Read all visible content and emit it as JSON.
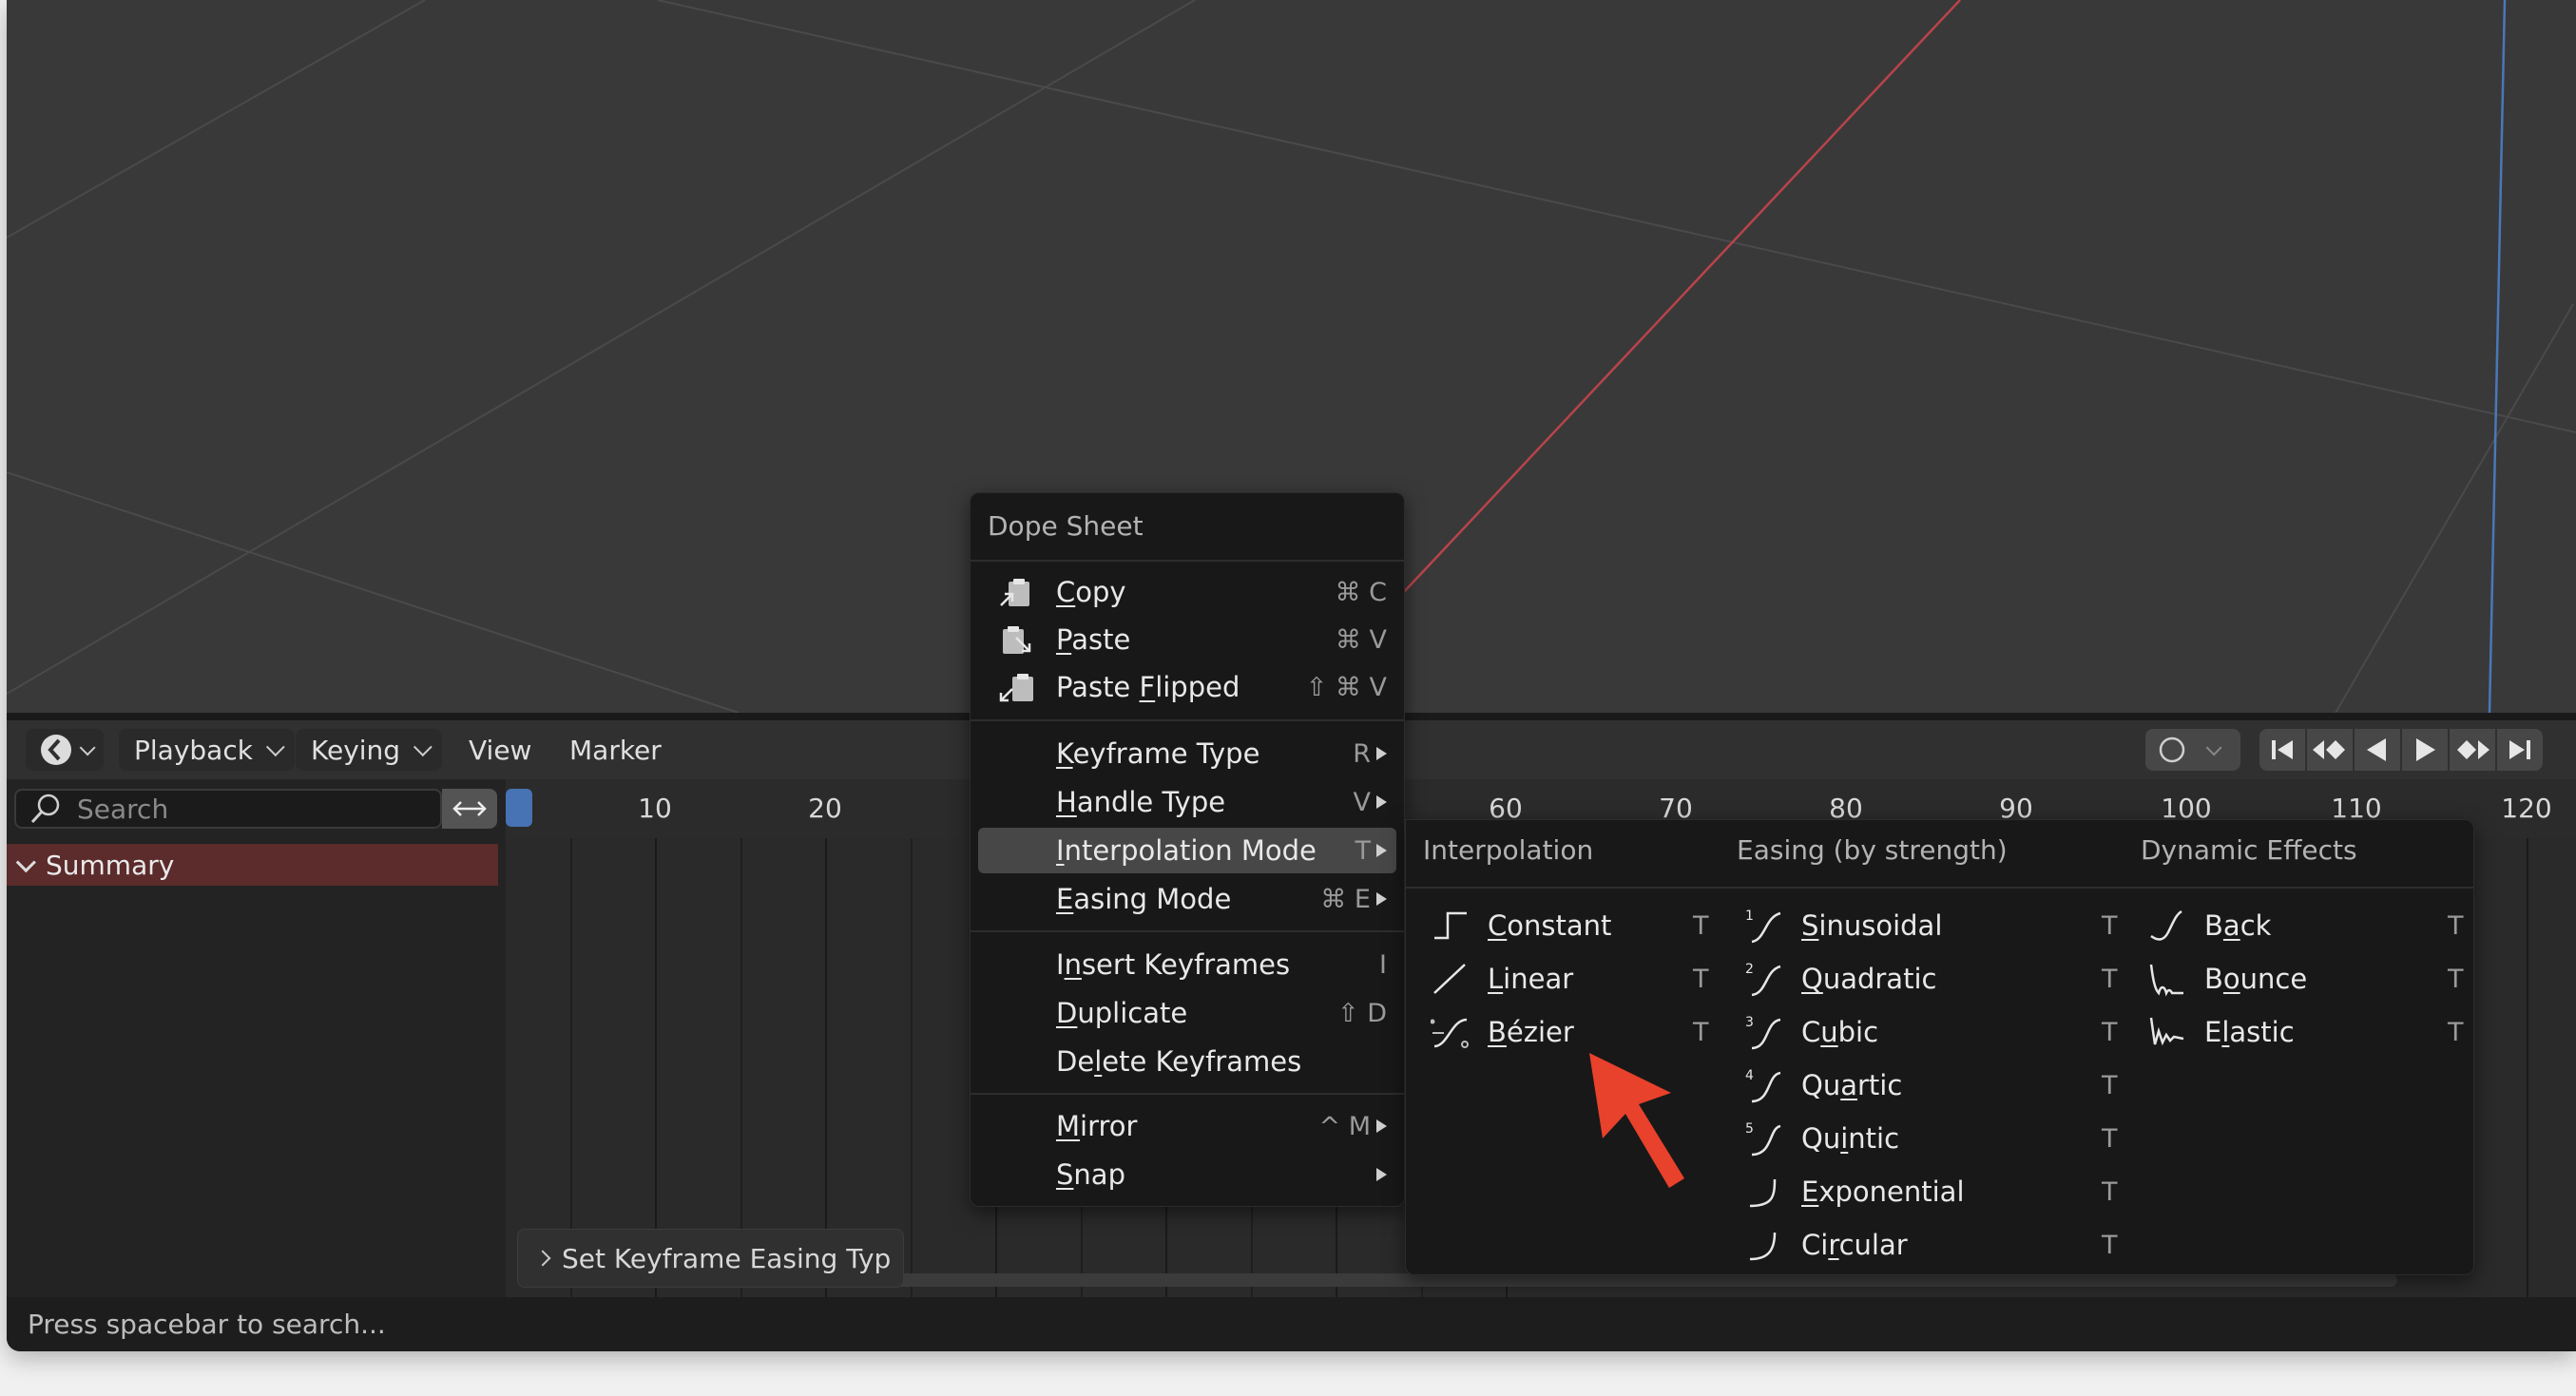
{
  "header": {
    "menus": [
      "Playback",
      "Keying",
      "View",
      "Marker"
    ]
  },
  "search": {
    "placeholder": "Search"
  },
  "channels": {
    "summary_label": "Summary"
  },
  "ruler": {
    "ticks": [
      "10",
      "20",
      "60",
      "70",
      "80",
      "90",
      "100",
      "110",
      "120"
    ]
  },
  "operator_panel": {
    "label": "Set Keyframe Easing Typ"
  },
  "status_bar": {
    "text": "Press spacebar to search..."
  },
  "context_menu": {
    "title": "Dope Sheet",
    "items": [
      {
        "label": "Copy",
        "shortcut": "⌘ C",
        "icon": "copy-icon"
      },
      {
        "label": "Paste",
        "shortcut": "⌘ V",
        "icon": "paste-icon"
      },
      {
        "label": "Paste Flipped",
        "shortcut": "⇧ ⌘ V",
        "icon": "paste-flipped-icon"
      },
      {
        "label": "Keyframe Type",
        "shortcut": "R"
      },
      {
        "label": "Handle Type",
        "shortcut": "V"
      },
      {
        "label": "Interpolation Mode",
        "shortcut": "T"
      },
      {
        "label": "Easing Mode",
        "shortcut": "⌘ E"
      },
      {
        "label": "Insert Keyframes",
        "shortcut": "I"
      },
      {
        "label": "Duplicate",
        "shortcut": "⇧ D"
      },
      {
        "label": "Delete Keyframes",
        "shortcut": ""
      },
      {
        "label": "Mirror",
        "shortcut": "^ M"
      },
      {
        "label": "Snap",
        "shortcut": ""
      }
    ]
  },
  "interpolation_submenu": {
    "columns": [
      {
        "header": "Interpolation",
        "items": [
          {
            "label": "Constant",
            "shortcut": "T"
          },
          {
            "label": "Linear",
            "shortcut": "T"
          },
          {
            "label": "Bézier",
            "shortcut": "T"
          }
        ]
      },
      {
        "header": "Easing (by strength)",
        "items": [
          {
            "label": "Sinusoidal",
            "shortcut": "T",
            "badge": "1"
          },
          {
            "label": "Quadratic",
            "shortcut": "T",
            "badge": "2"
          },
          {
            "label": "Cubic",
            "shortcut": "T",
            "badge": "3"
          },
          {
            "label": "Quartic",
            "shortcut": "T",
            "badge": "4"
          },
          {
            "label": "Quintic",
            "shortcut": "T",
            "badge": "5"
          },
          {
            "label": "Exponential",
            "shortcut": "T"
          },
          {
            "label": "Circular",
            "shortcut": "T"
          }
        ]
      },
      {
        "header": "Dynamic Effects",
        "items": [
          {
            "label": "Back",
            "shortcut": "T"
          },
          {
            "label": "Bounce",
            "shortcut": "T"
          },
          {
            "label": "Elastic",
            "shortcut": "T"
          }
        ]
      }
    ]
  },
  "colors": {
    "accent": "#4772b3",
    "summary_bg": "#5c2b2b",
    "annotation_arrow": "#e8412c",
    "x_axis": "#b8434b",
    "z_axis": "#4a78b8"
  }
}
